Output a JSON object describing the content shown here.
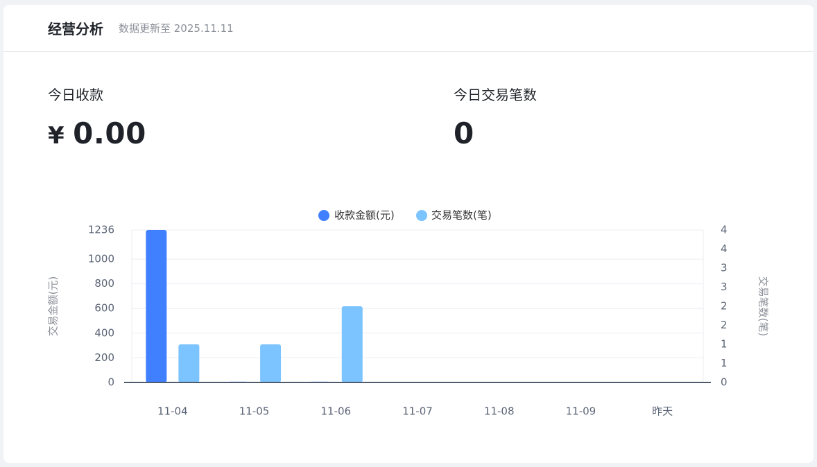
{
  "header": {
    "title": "经营分析",
    "updated": "数据更新至 2025.11.11"
  },
  "stats": {
    "receipts_label": "今日收款",
    "receipts_currency": "¥",
    "receipts_value": "0.00",
    "transactions_label": "今日交易笔数",
    "transactions_value": "0"
  },
  "colors": {
    "amount": "#4080ff",
    "count": "#7cc4ff",
    "axis": "#4e5a6e",
    "grid": "#eceef2"
  },
  "chart_data": {
    "type": "bar",
    "categories": [
      "11-04",
      "11-05",
      "11-06",
      "11-07",
      "11-08",
      "11-09",
      "昨天"
    ],
    "series": [
      {
        "name": "收款金额(元)",
        "axis": "left",
        "values": [
          1236,
          6,
          6,
          0,
          0,
          0,
          0
        ]
      },
      {
        "name": "交易笔数(笔)",
        "axis": "right",
        "values": [
          1,
          1,
          2,
          0,
          0,
          0,
          0
        ]
      }
    ],
    "ylabel": "交易金额(元)",
    "y2label": "交易笔数(笔)",
    "ylim": [
      0,
      1236
    ],
    "y2lim": [
      0,
      4
    ],
    "yticks": [
      0,
      200,
      400,
      600,
      800,
      1000,
      1236
    ],
    "y2ticks": [
      "0",
      "1",
      "1",
      "2",
      "2",
      "3",
      "3",
      "4",
      "4"
    ],
    "legend": "top-center",
    "grid": true
  }
}
